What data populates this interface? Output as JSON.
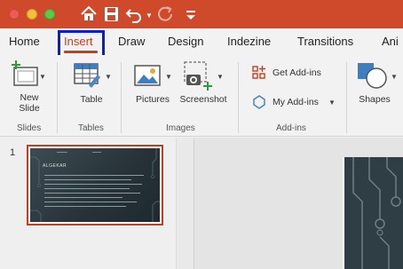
{
  "toolbar": {
    "icons": [
      "home-icon",
      "save-icon",
      "undo-icon",
      "redo-icon",
      "customize-icon"
    ],
    "colors": {
      "title_bar": "#cf4a2b",
      "accent": "#c43e1c",
      "highlight_box": "#0a1fcc"
    }
  },
  "tabs": [
    {
      "label": "Home"
    },
    {
      "label": "Insert",
      "active": true
    },
    {
      "label": "Draw"
    },
    {
      "label": "Design"
    },
    {
      "label": "Indezine"
    },
    {
      "label": "Transitions"
    },
    {
      "label": "Ani"
    }
  ],
  "ribbon": {
    "new_slide": {
      "line1": "New",
      "line2": "Slide"
    },
    "table": "Table",
    "pictures": "Pictures",
    "screenshot": "Screenshot",
    "get_addins": "Get Add-ins",
    "my_addins": "My Add-ins",
    "shapes": "Shapes",
    "groups": {
      "slides": "Slides",
      "tables": "Tables",
      "images": "Images",
      "addins": "Add-ins"
    }
  },
  "slides_panel": {
    "slide_number": "1",
    "thumbnail_title": "ALGEKAR"
  }
}
